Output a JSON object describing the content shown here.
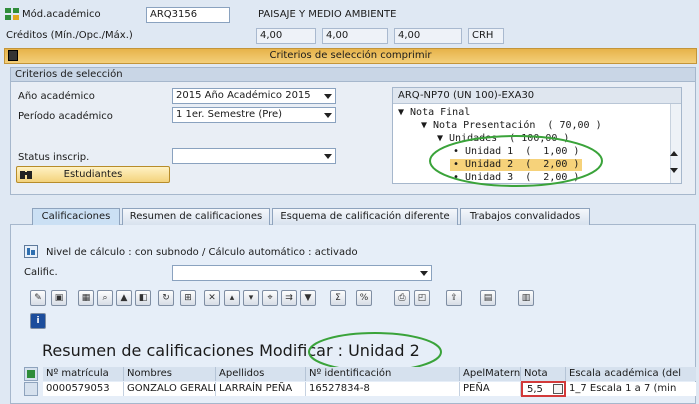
{
  "header": {
    "module_icon": "module-icon",
    "module_label": "Mód.académico",
    "module_code": "ARQ3156",
    "module_name": "PAISAJE Y MEDIO AMBIENTE",
    "credits_label": "Créditos (Mín./Opc./Máx.)",
    "credit_min": "4,00",
    "credit_opc": "4,00",
    "credit_max": "4,00",
    "credit_unit": "CRH"
  },
  "criteria_bar": {
    "title": "Criterios de selección comprimir",
    "icon": "collapse-icon"
  },
  "selection": {
    "title": "Criterios de selección",
    "year_label": "Año académico",
    "year_value": "2015 Año Académico 2015",
    "period_label": "Período académico",
    "period_value": "1 1er. Semestre (Pre)",
    "status_label": "Status inscrip.",
    "status_value": "",
    "students_button": "Estudiantes",
    "students_icon": "binoculars-icon"
  },
  "tree": {
    "header": "ARQ-NP70 (UN 100)-EXA30",
    "rows": [
      "▼ Nota Final",
      "▼ Nota Presentación  ( 70,00 )",
      "▼ Unidades  ( 100,00 )",
      "• Unidad 1  (  1,00 )",
      "• Unidad 2  (  2,00 )",
      "• Unidad 3  (  2,00 )"
    ],
    "highlight_color": "#f6d27a",
    "circle_color": "#3aa33a"
  },
  "tabs": [
    {
      "label": "Calificaciones",
      "active": true
    },
    {
      "label": "Resumen de calificaciones",
      "active": false
    },
    {
      "label": "Esquema de calificación diferente",
      "active": false
    },
    {
      "label": "Trabajos convalidados",
      "active": false
    }
  ],
  "grading": {
    "level_icon": "level-icon",
    "level_text": "Nivel de cálculo : con subnodo / Cálculo automático : activado",
    "calific_label": "Calific.",
    "calific_value": "",
    "info_icon": "info-icon"
  },
  "summary": {
    "title": "Resumen de calificaciones Modificar : Unidad 2",
    "columns": [
      "Nº matrícula",
      "Nombres",
      "Apellidos",
      "Nº identificación",
      "ApelMatern",
      "Nota",
      "Escala académica (del"
    ],
    "rows": [
      {
        "matricula": "0000579053",
        "nombres": "GONZALO GERALD",
        "apellidos": "LARRAÍN PEÑA",
        "identificacion": "16527834-8",
        "apel_matern": "PEÑA",
        "nota": "5,5",
        "escala": "1_7 Escala 1 a 7 (min"
      }
    ],
    "nota_highlight_color": "#d23a3a"
  },
  "toolbar_icons": [
    "edit-icon",
    "save-icon",
    "table-icon",
    "find-icon",
    "lock-icon",
    "detail-icon",
    "refresh-icon",
    "filter-icon",
    "print-icon",
    "sum-icon",
    "export-icon",
    "layout-icon",
    "variant-icon",
    "chart-icon"
  ]
}
